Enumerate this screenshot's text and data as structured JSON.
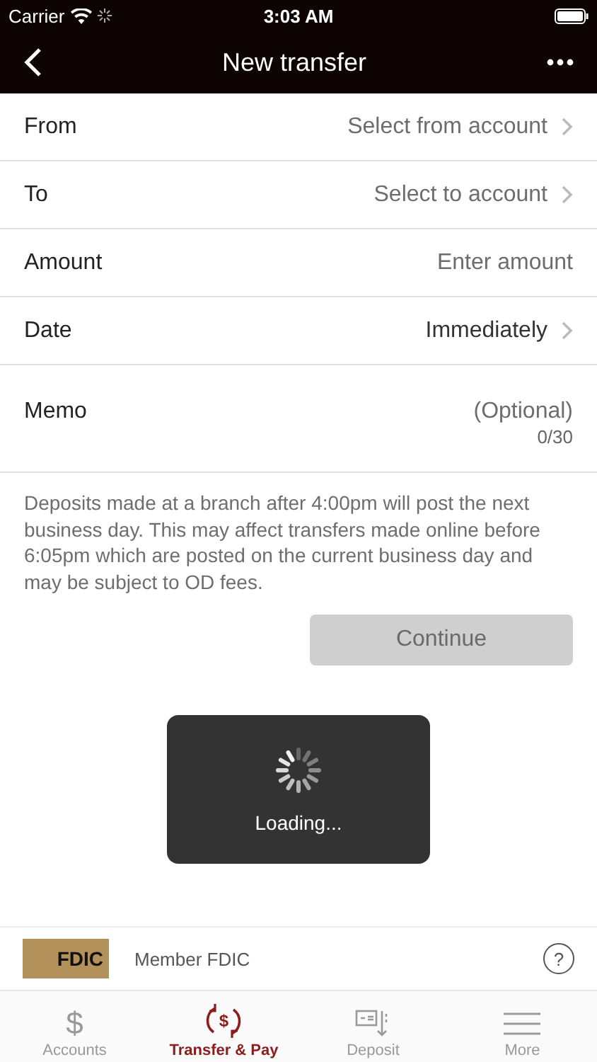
{
  "status_bar": {
    "carrier": "Carrier",
    "time": "3:03 AM"
  },
  "nav": {
    "title": "New transfer"
  },
  "fields": [
    {
      "label": "From",
      "value": "Select from account",
      "chevron": true
    },
    {
      "label": "To",
      "value": "Select to account",
      "chevron": true
    },
    {
      "label": "Amount",
      "value": "Enter amount",
      "chevron": false
    },
    {
      "label": "Date",
      "value": "Immediately",
      "chevron": true,
      "filled": true
    },
    {
      "label": "Memo",
      "value": "(Optional)",
      "chevron": false,
      "counter": "0/30"
    }
  ],
  "notice": "Deposits made at a branch after 4:00pm will post the next business day. This may affect transfers made online before 6:05pm which are posted on the current business day and may be subject to OD fees.",
  "continue_button": {
    "label": "Continue",
    "disabled": true
  },
  "loading": {
    "label": "Loading..."
  },
  "footer": {
    "logo": "FDIC",
    "text": "Member FDIC",
    "help": "?"
  },
  "tabs": [
    {
      "label": "Accounts",
      "glyph": "$",
      "selected": false
    },
    {
      "label": "Transfer & Pay",
      "glyph": "$",
      "selected": true
    },
    {
      "label": "Deposit",
      "selected": false
    },
    {
      "label": "More",
      "selected": false
    }
  ]
}
